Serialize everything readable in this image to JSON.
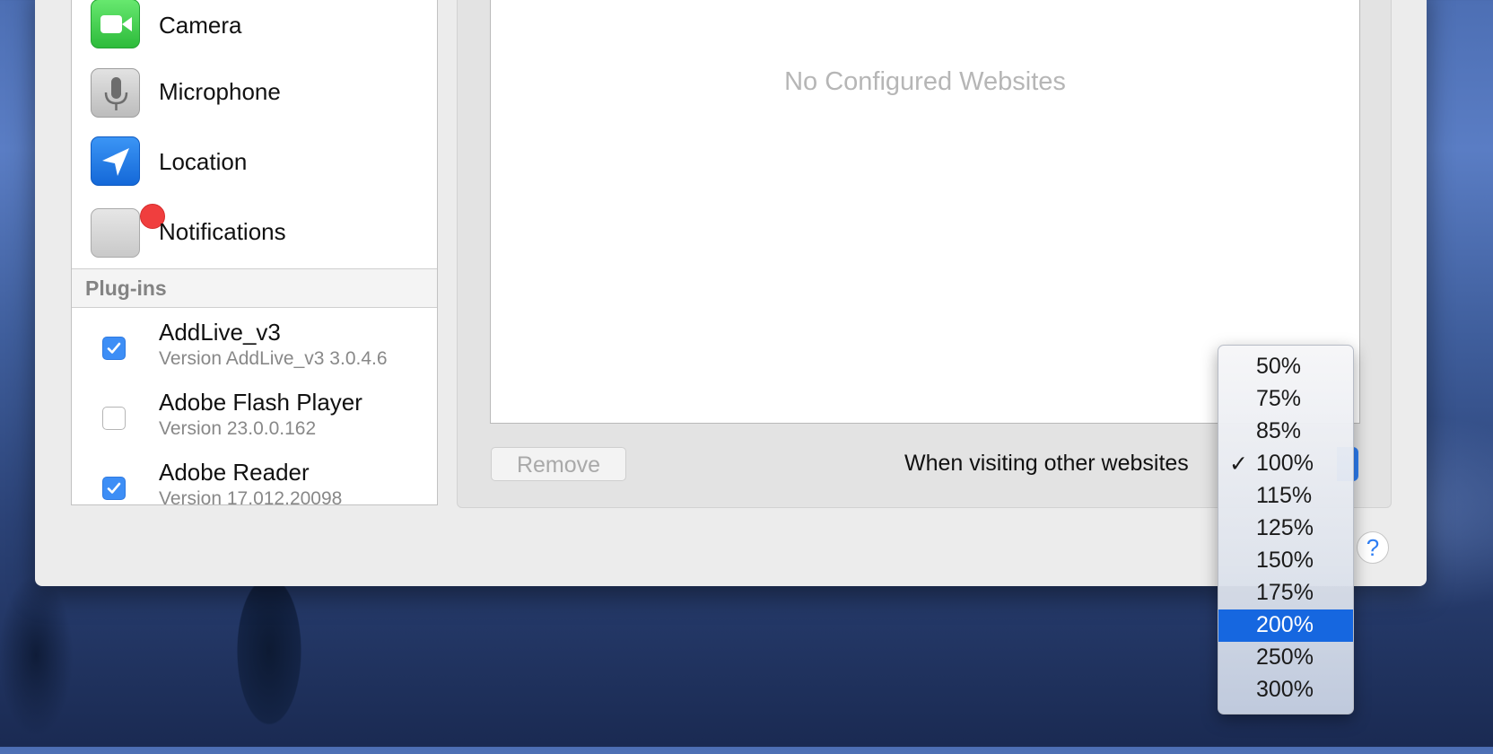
{
  "permissions": [
    {
      "label": "Camera",
      "icon": "camera-icon"
    },
    {
      "label": "Microphone",
      "icon": "microphone-icon"
    },
    {
      "label": "Location",
      "icon": "location-icon"
    },
    {
      "label": "Notifications",
      "icon": "notifications-icon"
    }
  ],
  "plugins_header": "Plug-ins",
  "plugins": [
    {
      "name": "AddLive_v3",
      "version": "Version AddLive_v3 3.0.4.6",
      "checked": true
    },
    {
      "name": "Adobe Flash Player",
      "version": "Version 23.0.0.162",
      "checked": false
    },
    {
      "name": "Adobe Reader",
      "version": "Version 17.012.20098",
      "checked": true
    }
  ],
  "websites": {
    "empty_text": "No Configured Websites",
    "remove_label": "Remove",
    "other_label": "When visiting other websites"
  },
  "help": {
    "label": "?"
  },
  "zoom_menu": {
    "items": [
      "50%",
      "75%",
      "85%",
      "100%",
      "115%",
      "125%",
      "150%",
      "175%",
      "200%",
      "250%",
      "300%"
    ],
    "checked": "100%",
    "highlighted": "200%",
    "check_glyph": "✓"
  },
  "colors": {
    "accent": "#1667e0",
    "checkbox": "#3d8ef6",
    "badge": "#f03e3e"
  }
}
